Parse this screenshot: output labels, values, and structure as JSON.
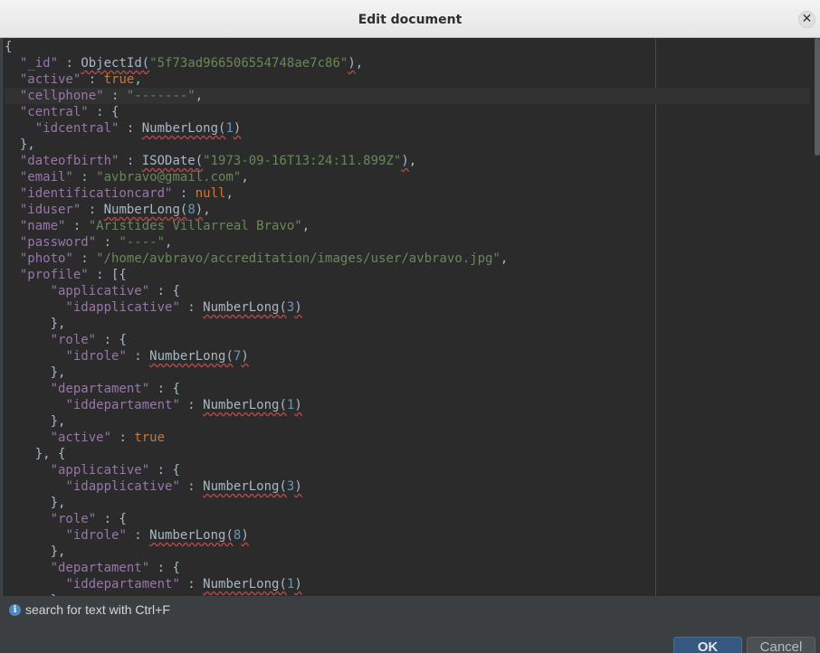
{
  "dialog": {
    "title": "Edit document",
    "close_glyph": "✕",
    "hint": "search for text with Ctrl+F",
    "ok_label": "OK",
    "cancel_label": "Cancel"
  },
  "editor": {
    "current_line_index": 3,
    "lines": [
      [
        [
          "p",
          "{"
        ]
      ],
      [
        [
          "p",
          "  "
        ],
        [
          "k",
          "\"_id\""
        ],
        [
          "p",
          " : "
        ],
        [
          "fn",
          "ObjectId("
        ],
        [
          "s",
          "\"5f73ad966506554748ae7c86\""
        ],
        [
          "fn",
          ")"
        ],
        [
          "p",
          ","
        ]
      ],
      [
        [
          "p",
          "  "
        ],
        [
          "k",
          "\"active\""
        ],
        [
          "p",
          " : "
        ],
        [
          "kw",
          "true"
        ],
        [
          "p",
          ","
        ]
      ],
      [
        [
          "p",
          "  "
        ],
        [
          "k",
          "\"cellphone\""
        ],
        [
          "p",
          " : "
        ],
        [
          "s",
          "\"-------\""
        ],
        [
          "p",
          ","
        ]
      ],
      [
        [
          "p",
          "  "
        ],
        [
          "k",
          "\"central\""
        ],
        [
          "p",
          " : {"
        ]
      ],
      [
        [
          "p",
          "    "
        ],
        [
          "k",
          "\"idcentral\""
        ],
        [
          "p",
          " : "
        ],
        [
          "fn",
          "NumberLong("
        ],
        [
          "n",
          "1"
        ],
        [
          "fn",
          ")"
        ]
      ],
      [
        [
          "p",
          "  },"
        ]
      ],
      [
        [
          "p",
          "  "
        ],
        [
          "k",
          "\"dateofbirth\""
        ],
        [
          "p",
          " : "
        ],
        [
          "fn",
          "ISODate("
        ],
        [
          "s",
          "\"1973-09-16T13:24:11.899Z\""
        ],
        [
          "fn",
          ")"
        ],
        [
          "p",
          ","
        ]
      ],
      [
        [
          "p",
          "  "
        ],
        [
          "k",
          "\"email\""
        ],
        [
          "p",
          " : "
        ],
        [
          "s",
          "\"avbravo@gmail.com\""
        ],
        [
          "p",
          ","
        ]
      ],
      [
        [
          "p",
          "  "
        ],
        [
          "k",
          "\"identificationcard\""
        ],
        [
          "p",
          " : "
        ],
        [
          "kw",
          "null"
        ],
        [
          "p",
          ","
        ]
      ],
      [
        [
          "p",
          "  "
        ],
        [
          "k",
          "\"iduser\""
        ],
        [
          "p",
          " : "
        ],
        [
          "fn",
          "NumberLong("
        ],
        [
          "n",
          "8"
        ],
        [
          "fn",
          ")"
        ],
        [
          "p",
          ","
        ]
      ],
      [
        [
          "p",
          "  "
        ],
        [
          "k",
          "\"name\""
        ],
        [
          "p",
          " : "
        ],
        [
          "s",
          "\"Aristides Villarreal Bravo\""
        ],
        [
          "p",
          ","
        ]
      ],
      [
        [
          "p",
          "  "
        ],
        [
          "k",
          "\"password\""
        ],
        [
          "p",
          " : "
        ],
        [
          "s",
          "\"----\""
        ],
        [
          "p",
          ","
        ]
      ],
      [
        [
          "p",
          "  "
        ],
        [
          "k",
          "\"photo\""
        ],
        [
          "p",
          " : "
        ],
        [
          "s",
          "\"/home/avbravo/accreditation/images/user/avbravo.jpg\""
        ],
        [
          "p",
          ","
        ]
      ],
      [
        [
          "p",
          "  "
        ],
        [
          "k",
          "\"profile\""
        ],
        [
          "p",
          " : [{"
        ]
      ],
      [
        [
          "p",
          "      "
        ],
        [
          "k",
          "\"applicative\""
        ],
        [
          "p",
          " : {"
        ]
      ],
      [
        [
          "p",
          "        "
        ],
        [
          "k",
          "\"idapplicative\""
        ],
        [
          "p",
          " : "
        ],
        [
          "fn",
          "NumberLong("
        ],
        [
          "n",
          "3"
        ],
        [
          "fn",
          ")"
        ]
      ],
      [
        [
          "p",
          "      },"
        ]
      ],
      [
        [
          "p",
          "      "
        ],
        [
          "k",
          "\"role\""
        ],
        [
          "p",
          " : {"
        ]
      ],
      [
        [
          "p",
          "        "
        ],
        [
          "k",
          "\"idrole\""
        ],
        [
          "p",
          " : "
        ],
        [
          "fn",
          "NumberLong("
        ],
        [
          "n",
          "7"
        ],
        [
          "fn",
          ")"
        ]
      ],
      [
        [
          "p",
          "      },"
        ]
      ],
      [
        [
          "p",
          "      "
        ],
        [
          "k",
          "\"departament\""
        ],
        [
          "p",
          " : {"
        ]
      ],
      [
        [
          "p",
          "        "
        ],
        [
          "k",
          "\"iddepartament\""
        ],
        [
          "p",
          " : "
        ],
        [
          "fn",
          "NumberLong("
        ],
        [
          "n",
          "1"
        ],
        [
          "fn",
          ")"
        ]
      ],
      [
        [
          "p",
          "      },"
        ]
      ],
      [
        [
          "p",
          "      "
        ],
        [
          "k",
          "\"active\""
        ],
        [
          "p",
          " : "
        ],
        [
          "kw",
          "true"
        ]
      ],
      [
        [
          "p",
          "    }, {"
        ]
      ],
      [
        [
          "p",
          "      "
        ],
        [
          "k",
          "\"applicative\""
        ],
        [
          "p",
          " : {"
        ]
      ],
      [
        [
          "p",
          "        "
        ],
        [
          "k",
          "\"idapplicative\""
        ],
        [
          "p",
          " : "
        ],
        [
          "fn",
          "NumberLong("
        ],
        [
          "n",
          "3"
        ],
        [
          "fn",
          ")"
        ]
      ],
      [
        [
          "p",
          "      },"
        ]
      ],
      [
        [
          "p",
          "      "
        ],
        [
          "k",
          "\"role\""
        ],
        [
          "p",
          " : {"
        ]
      ],
      [
        [
          "p",
          "        "
        ],
        [
          "k",
          "\"idrole\""
        ],
        [
          "p",
          " : "
        ],
        [
          "fn",
          "NumberLong("
        ],
        [
          "n",
          "8"
        ],
        [
          "fn",
          ")"
        ]
      ],
      [
        [
          "p",
          "      },"
        ]
      ],
      [
        [
          "p",
          "      "
        ],
        [
          "k",
          "\"departament\""
        ],
        [
          "p",
          " : {"
        ]
      ],
      [
        [
          "p",
          "        "
        ],
        [
          "k",
          "\"iddepartament\""
        ],
        [
          "p",
          " : "
        ],
        [
          "fn",
          "NumberLong("
        ],
        [
          "n",
          "1"
        ],
        [
          "fn",
          ")"
        ]
      ],
      [
        [
          "p",
          "      }"
        ]
      ]
    ]
  }
}
